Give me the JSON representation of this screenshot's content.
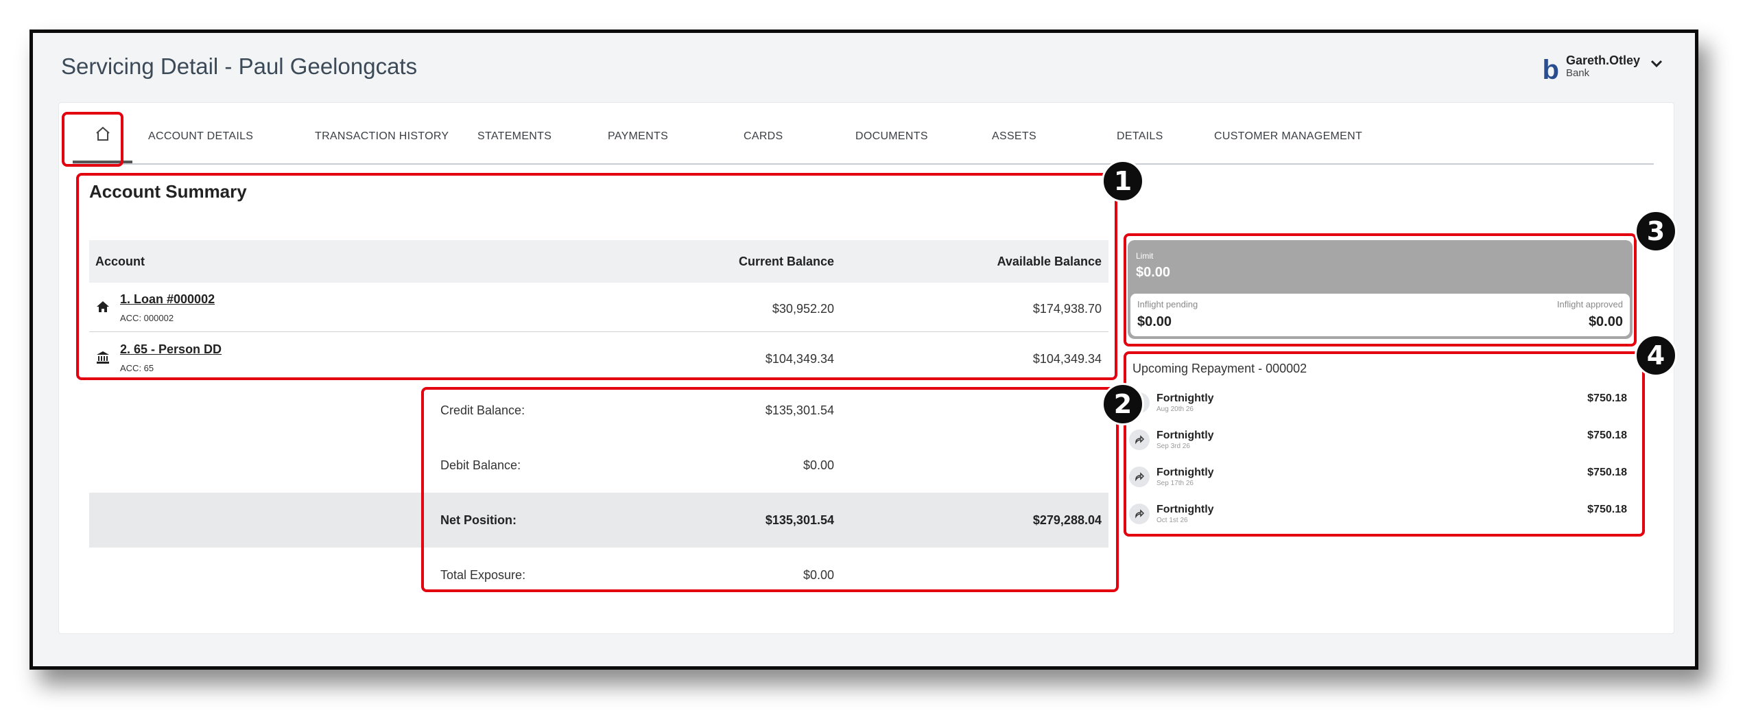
{
  "header": {
    "title": "Servicing Detail - Paul Geelongcats",
    "user": {
      "logo": "b",
      "name": "Gareth.Otley",
      "role": "Bank"
    }
  },
  "tabs": [
    {
      "label": "ACCOUNT DETAILS"
    },
    {
      "label": "TRANSACTION HISTORY"
    },
    {
      "label": "STATEMENTS"
    },
    {
      "label": "PAYMENTS"
    },
    {
      "label": "CARDS"
    },
    {
      "label": "DOCUMENTS"
    },
    {
      "label": "ASSETS"
    },
    {
      "label": "DETAILS"
    },
    {
      "label": "CUSTOMER MANAGEMENT"
    }
  ],
  "summary": {
    "title": "Account Summary",
    "columns": {
      "account": "Account",
      "current": "Current Balance",
      "available": "Available Balance"
    },
    "accounts": [
      {
        "icon": "home-icon",
        "name": "1. Loan #000002",
        "acc": "ACC: 000002",
        "current": "$30,952.20",
        "available": "$174,938.70"
      },
      {
        "icon": "bank-icon",
        "name": "2. 65 - Person DD",
        "acc": "ACC: 65",
        "current": "$104,349.34",
        "available": "$104,349.34"
      }
    ]
  },
  "balances": {
    "credit": {
      "label": "Credit Balance:",
      "value": "$135,301.54"
    },
    "debit": {
      "label": "Debit Balance:",
      "value": "$0.00"
    },
    "net": {
      "label": "Net Position:",
      "value": "$135,301.54",
      "available": "$279,288.04"
    },
    "exposure": {
      "label": "Total Exposure:",
      "value": "$0.00"
    }
  },
  "limit": {
    "label": "Limit",
    "value": "$0.00",
    "inflight_pending_label": "Inflight pending",
    "inflight_pending": "$0.00",
    "inflight_approved_label": "Inflight approved",
    "inflight_approved": "$0.00"
  },
  "repayments": {
    "title": "Upcoming Repayment - 000002",
    "items": [
      {
        "freq": "Fortnightly",
        "date": "Aug 20th 26",
        "amount": "$750.18"
      },
      {
        "freq": "Fortnightly",
        "date": "Sep 3rd 26",
        "amount": "$750.18"
      },
      {
        "freq": "Fortnightly",
        "date": "Sep 17th 26",
        "amount": "$750.18"
      },
      {
        "freq": "Fortnightly",
        "date": "Oct 1st 26",
        "amount": "$750.18"
      }
    ]
  },
  "annotations": [
    "1",
    "2",
    "3",
    "4"
  ],
  "colors": {
    "highlight": "#e3000f",
    "brand": "#2a4d8f",
    "limit_bg": "#a6a6a6"
  }
}
